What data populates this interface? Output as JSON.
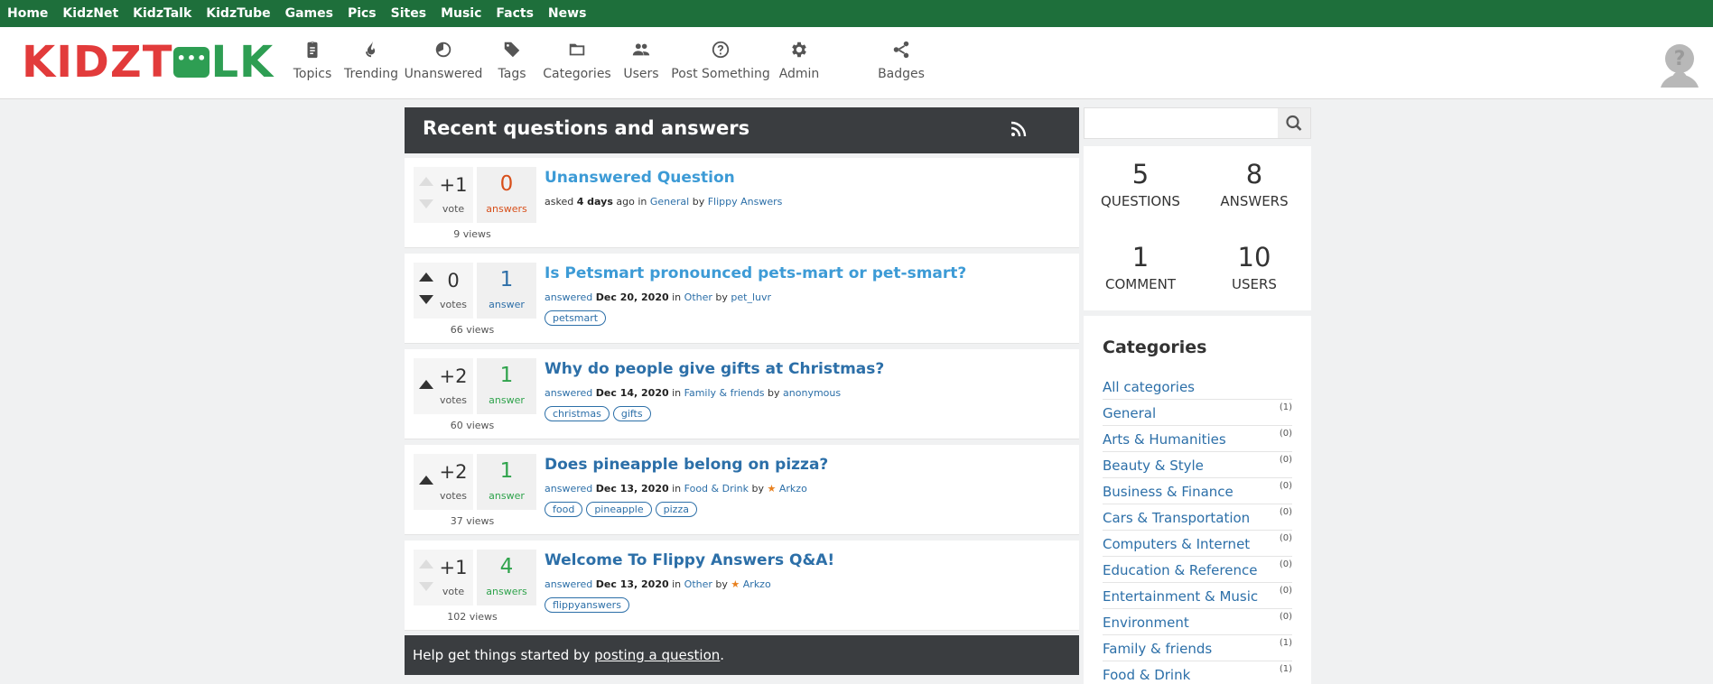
{
  "topnav": [
    "Home",
    "KidzNet",
    "KidzTalk",
    "KidzTube",
    "Games",
    "Pics",
    "Sites",
    "Music",
    "Facts",
    "News"
  ],
  "logo": {
    "part1": "KIDZT",
    "part2": "LK"
  },
  "nav": [
    {
      "label": "Topics",
      "icon": "clipboard-icon"
    },
    {
      "label": "Trending",
      "icon": "flame-icon"
    },
    {
      "label": "Unanswered",
      "icon": "unanswered-icon"
    },
    {
      "label": "Tags",
      "icon": "tag-icon"
    },
    {
      "label": "Categories",
      "icon": "folder-icon"
    },
    {
      "label": "Users",
      "icon": "users-icon"
    },
    {
      "label": "Post Something",
      "icon": "question-icon"
    },
    {
      "label": "Admin",
      "icon": "gear-icon"
    },
    {
      "label": "Badges",
      "icon": "share-icon"
    }
  ],
  "main": {
    "heading": "Recent questions and answers",
    "questions": [
      {
        "title": "Unanswered Question",
        "votes": "+1",
        "votes_label": "vote",
        "answers": "0",
        "answers_label": "answers",
        "views": "9 views",
        "action": "asked",
        "when": "4 days",
        "suffix": " ago",
        "in": "in",
        "category": "General",
        "by": "by",
        "user": "Flippy Answers",
        "tags": []
      },
      {
        "title": "Is Petsmart pronounced pets-mart or pet-smart?",
        "votes": "0",
        "votes_label": "votes",
        "answers": "1",
        "answers_label": "answer",
        "views": "66 views",
        "action": "answered",
        "when": "Dec 20, 2020",
        "suffix": "",
        "in": "in",
        "category": "Other",
        "by": "by",
        "user": "pet_luvr",
        "tags": [
          "petsmart"
        ]
      },
      {
        "title": "Why do people give gifts at Christmas?",
        "votes": "+2",
        "votes_label": "votes",
        "answers": "1",
        "answers_label": "answer",
        "views": "60 views",
        "action": "answered",
        "when": "Dec 14, 2020",
        "suffix": "",
        "in": "in",
        "category": "Family & friends",
        "by": "by",
        "user": "anonymous",
        "tags": [
          "christmas",
          "gifts"
        ]
      },
      {
        "title": "Does pineapple belong on pizza?",
        "votes": "+2",
        "votes_label": "votes",
        "answers": "1",
        "answers_label": "answer",
        "views": "37 views",
        "action": "answered",
        "when": "Dec 13, 2020",
        "suffix": "",
        "in": "in",
        "category": "Food & Drink",
        "by": "by",
        "user": "Arkzo",
        "tags": [
          "food",
          "pineapple",
          "pizza"
        ]
      },
      {
        "title": "Welcome To Flippy Answers Q&A!",
        "votes": "+1",
        "votes_label": "vote",
        "answers": "4",
        "answers_label": "answers",
        "views": "102 views",
        "action": "answered",
        "when": "Dec 13, 2020",
        "suffix": "",
        "in": "in",
        "category": "Other",
        "by": "by",
        "user": "Arkzo",
        "tags": [
          "flippyanswers"
        ]
      }
    ],
    "help_prefix": "Help get things started by ",
    "help_link": "posting a question",
    "help_suffix": "."
  },
  "sidebar": {
    "search_placeholder": "",
    "stats": [
      {
        "n": "5",
        "l": "QUESTIONS"
      },
      {
        "n": "8",
        "l": "ANSWERS"
      },
      {
        "n": "1",
        "l": "COMMENT"
      },
      {
        "n": "10",
        "l": "USERS"
      }
    ],
    "categories_heading": "Categories",
    "categories": [
      {
        "name": "All categories",
        "count": ""
      },
      {
        "name": "General",
        "count": "(1)"
      },
      {
        "name": "Arts & Humanities",
        "count": "(0)"
      },
      {
        "name": "Beauty & Style",
        "count": "(0)"
      },
      {
        "name": "Business & Finance",
        "count": "(0)"
      },
      {
        "name": "Cars & Transportation",
        "count": "(0)"
      },
      {
        "name": "Computers & Internet",
        "count": "(0)"
      },
      {
        "name": "Education & Reference",
        "count": "(0)"
      },
      {
        "name": "Entertainment & Music",
        "count": "(0)"
      },
      {
        "name": "Environment",
        "count": "(0)"
      },
      {
        "name": "Family & friends",
        "count": "(1)"
      },
      {
        "name": "Food & Drink",
        "count": "(1)"
      }
    ]
  },
  "colors": {
    "topbar": "#1e6f3b",
    "logo_red": "#e23b3b",
    "logo_green": "#2e9e53",
    "link": "#2c6fa8",
    "dark": "#3a3d40"
  }
}
